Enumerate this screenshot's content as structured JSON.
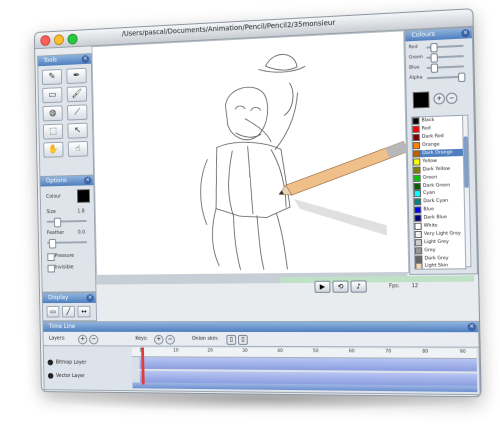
{
  "window": {
    "title": "/Users/pascal/Documents/Animation/Pencil/Pencil2/35monsieur"
  },
  "tools_panel": {
    "title": "Tools",
    "tools": [
      "pencil-tool",
      "pen-tool",
      "eraser-tool",
      "brush-tool",
      "bucket-tool",
      "eyedropper-tool",
      "select-tool",
      "move-tool",
      "hand-tool",
      "smudge-tool"
    ]
  },
  "options_panel": {
    "title": "Options",
    "colour_label": "Colour",
    "size_label": "Size",
    "size_value": "1.8",
    "feather_label": "Feather",
    "feather_value": "0.0",
    "pressure_label": "Pressure",
    "invisible_label": "Invisible",
    "colour_swatch": "#000000"
  },
  "display_panel": {
    "title": "Display"
  },
  "colours_panel": {
    "title": "Colours",
    "sliders": [
      {
        "label": "Red"
      },
      {
        "label": "Green"
      },
      {
        "label": "Blue"
      },
      {
        "label": "Alpha"
      }
    ],
    "swatch": "#000000",
    "items": [
      {
        "name": "Black",
        "color": "#000000"
      },
      {
        "name": "Red",
        "color": "#ff0000"
      },
      {
        "name": "Dark Red",
        "color": "#800000"
      },
      {
        "name": "Orange",
        "color": "#ff8000"
      },
      {
        "name": "Dark Orange",
        "color": "#c06000"
      },
      {
        "name": "Yellow",
        "color": "#ffff00"
      },
      {
        "name": "Dark Yellow",
        "color": "#808000"
      },
      {
        "name": "Green",
        "color": "#00cc00"
      },
      {
        "name": "Dark Green",
        "color": "#006000"
      },
      {
        "name": "Cyan",
        "color": "#00ffff"
      },
      {
        "name": "Dark Cyan",
        "color": "#008080"
      },
      {
        "name": "Blue",
        "color": "#0000ff"
      },
      {
        "name": "Dark Blue",
        "color": "#000080"
      },
      {
        "name": "White",
        "color": "#ffffff"
      },
      {
        "name": "Very Light Grey",
        "color": "#eeeeee"
      },
      {
        "name": "Light Grey",
        "color": "#cccccc"
      },
      {
        "name": "Grey",
        "color": "#999999"
      },
      {
        "name": "Dark Grey",
        "color": "#666666"
      },
      {
        "name": "Light Skin",
        "color": "#f5d6b8"
      }
    ]
  },
  "playback": {
    "fps_label": "Fps:",
    "fps_value": "12"
  },
  "timeline": {
    "title": "Time Line",
    "layers_label": "Layers:",
    "keys_label": "Keys:",
    "onion_label": "Onion skin:",
    "ruler_ticks": [
      "1",
      "10",
      "20",
      "30",
      "40",
      "50",
      "60",
      "70",
      "80",
      "90"
    ],
    "layers": [
      {
        "name": "Bitmap Layer"
      },
      {
        "name": "Vector Layer"
      }
    ]
  }
}
